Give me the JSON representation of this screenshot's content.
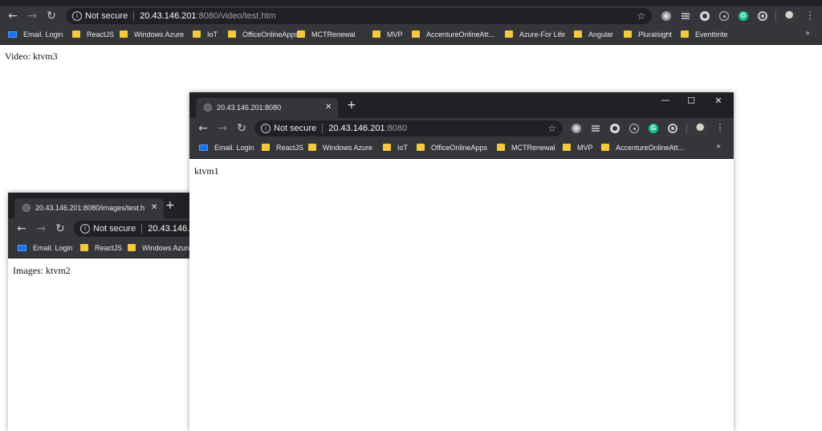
{
  "main_browser": {
    "omnibox": {
      "security_label": "Not secure",
      "host": "20.43.146.201",
      "path": ":8080/video/test.htm"
    },
    "bookmarks": [
      {
        "label": "Email. Login",
        "icon": "mail-icon"
      },
      {
        "label": "ReactJS",
        "icon": "folder-icon"
      },
      {
        "label": "Windows Azure",
        "icon": "folder-icon"
      },
      {
        "label": "IoT",
        "icon": "folder-icon"
      },
      {
        "label": "OfficeOnlineApps",
        "icon": "folder-icon"
      },
      {
        "label": "MCTRenewal",
        "icon": "folder-icon"
      },
      {
        "label": "MVP",
        "icon": "folder-icon"
      },
      {
        "label": "AccentureOnlineAtt...",
        "icon": "folder-icon"
      },
      {
        "label": "Azure-For Life",
        "icon": "folder-icon"
      },
      {
        "label": "Angular",
        "icon": "folder-icon"
      },
      {
        "label": "Pluralsight",
        "icon": "folder-icon"
      },
      {
        "label": "Eventbrite",
        "icon": "folder-icon"
      }
    ],
    "bookmarks_more": "»",
    "page_text": "Video: ktvm3"
  },
  "images_window": {
    "tab_title": "20.43.146.201:8080/images/test.h",
    "omnibox": {
      "security_label": "Not secure",
      "host": "20.43.146.20"
    },
    "bookmarks": [
      {
        "label": "Email. Login",
        "icon": "mail-icon"
      },
      {
        "label": "ReactJS",
        "icon": "folder-icon"
      },
      {
        "label": "Windows Azure",
        "icon": "folder-icon"
      }
    ],
    "page_text": "Images: ktvm2"
  },
  "root_window": {
    "tab_title": "20.43.146.201:8080",
    "omnibox": {
      "security_label": "Not secure",
      "host": "20.43.146.201",
      "path": ":8080"
    },
    "bookmarks": [
      {
        "label": "Email. Login",
        "icon": "mail-icon"
      },
      {
        "label": "ReactJS",
        "icon": "folder-icon"
      },
      {
        "label": "Windows Azure",
        "icon": "folder-icon"
      },
      {
        "label": "IoT",
        "icon": "folder-icon"
      },
      {
        "label": "OfficeOnlineApps",
        "icon": "folder-icon"
      },
      {
        "label": "MCTRenewal",
        "icon": "folder-icon"
      },
      {
        "label": "MVP",
        "icon": "folder-icon"
      },
      {
        "label": "AccentureOnlineAtt...",
        "icon": "folder-icon"
      }
    ],
    "bookmarks_more": "»",
    "page_text": "ktvm1"
  },
  "icons": {
    "back": "←",
    "forward": "→",
    "reload": "↻",
    "star": "☆",
    "kebab": "⋮",
    "close": "✕",
    "new_tab": "+",
    "info": "i",
    "minimize": "—",
    "maximize": "☐",
    "grammarly": "G"
  },
  "colors": {
    "chrome_dark": "#202124",
    "toolbar": "#35363a",
    "omnibox": "#202124",
    "folder": "#f5c842",
    "grammarly": "#15c39a"
  }
}
